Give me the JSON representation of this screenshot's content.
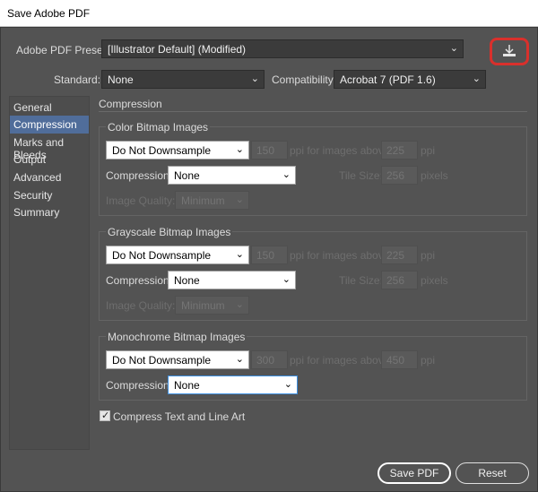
{
  "window": {
    "title": "Save Adobe PDF"
  },
  "preset": {
    "label": "Adobe PDF Preset:",
    "value": "[Illustrator Default] (Modified)"
  },
  "save_preset_icon": "save-preset-icon",
  "standard": {
    "label": "Standard:",
    "value": "None"
  },
  "compatibility": {
    "label": "Compatibility:",
    "value": "Acrobat 7 (PDF 1.6)"
  },
  "nav": {
    "items": [
      {
        "label": "General"
      },
      {
        "label": "Compression"
      },
      {
        "label": "Marks and Bleeds"
      },
      {
        "label": "Output"
      },
      {
        "label": "Advanced"
      },
      {
        "label": "Security"
      },
      {
        "label": "Summary"
      }
    ],
    "selected": "Compression"
  },
  "section_title": "Compression",
  "color": {
    "title": "Color Bitmap Images",
    "downsample": "Do Not Downsample",
    "ppi": "150",
    "ppi_above_label": "ppi for images above",
    "above": "225",
    "ppi_unit": "ppi",
    "compression_label": "Compression:",
    "compression": "None",
    "tile_label": "Tile Size:",
    "tile": "256",
    "tile_unit": "pixels",
    "quality_label": "Image Quality:",
    "quality": "Minimum"
  },
  "grayscale": {
    "title": "Grayscale Bitmap Images",
    "downsample": "Do Not Downsample",
    "ppi": "150",
    "ppi_above_label": "ppi for images above",
    "above": "225",
    "ppi_unit": "ppi",
    "compression_label": "Compression:",
    "compression": "None",
    "tile_label": "Tile Size:",
    "tile": "256",
    "tile_unit": "pixels",
    "quality_label": "Image Quality:",
    "quality": "Minimum"
  },
  "monochrome": {
    "title": "Monochrome Bitmap Images",
    "downsample": "Do Not Downsample",
    "ppi": "300",
    "ppi_above_label": "ppi for images above",
    "above": "450",
    "ppi_unit": "ppi",
    "compression_label": "Compression:",
    "compression": "None"
  },
  "compress_text": {
    "label": "Compress Text and Line Art",
    "checked": true
  },
  "buttons": {
    "save": "Save PDF",
    "reset": "Reset"
  },
  "colors": {
    "accent": "#506d9a",
    "highlight": "#d9302c",
    "focus": "#3d8fe0"
  }
}
